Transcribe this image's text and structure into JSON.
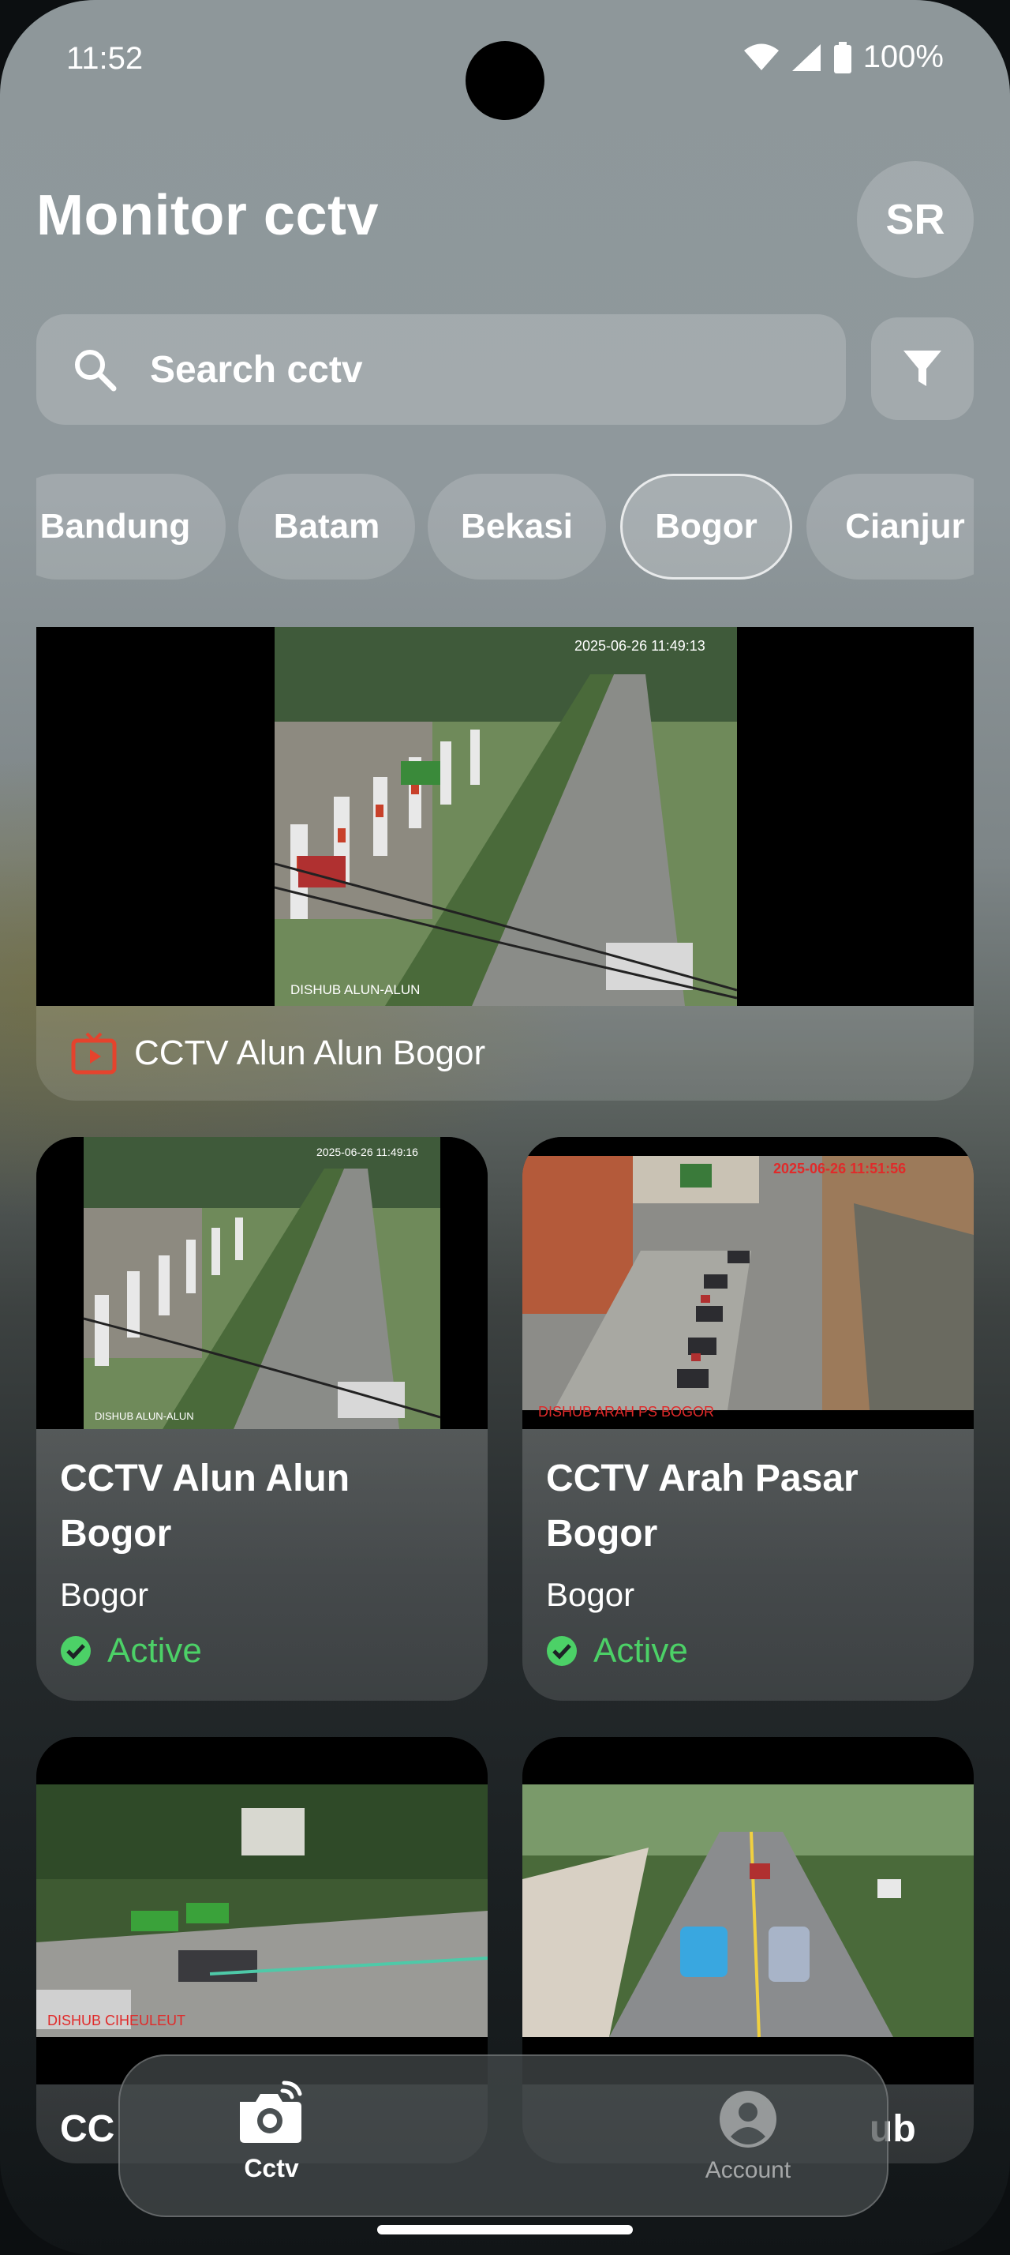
{
  "status_bar": {
    "time": "11:52",
    "battery": "100%"
  },
  "header": {
    "title": "Monitor cctv",
    "avatar_initials": "SR"
  },
  "search": {
    "placeholder": "Search cctv"
  },
  "city_chips": [
    {
      "label": "Bandung",
      "selected": false
    },
    {
      "label": "Batam",
      "selected": false
    },
    {
      "label": "Bekasi",
      "selected": false
    },
    {
      "label": "Bogor",
      "selected": true
    },
    {
      "label": "Cianjur",
      "selected": false
    }
  ],
  "featured": {
    "title": "CCTV Alun Alun Bogor",
    "overlay_timestamp": "2025-06-26 11:49:13",
    "overlay_label": "DISHUB ALUN-ALUN"
  },
  "cameras": [
    {
      "title": "CCTV Alun Alun Bogor",
      "city": "Bogor",
      "status": "Active",
      "overlay_timestamp": "2025-06-26 11:49:16",
      "overlay_label": "DISHUB ALUN-ALUN"
    },
    {
      "title": "CCTV Arah Pasar Bogor",
      "city": "Bogor",
      "status": "Active",
      "overlay_timestamp": "2025-06-26 11:51:56",
      "overlay_label": "DISHUB ARAH PS BOGOR"
    },
    {
      "title": "CC",
      "overlay_label": "DISHUB CIHEULEUT"
    },
    {
      "title": "ub"
    }
  ],
  "bottom_nav": {
    "items": [
      {
        "label": "Cctv",
        "icon": "camera-icon",
        "active": true
      },
      {
        "label": "Account",
        "icon": "account-icon",
        "active": false
      }
    ]
  },
  "colors": {
    "active_status": "#4cd167",
    "tv_icon": "#e5432d"
  }
}
